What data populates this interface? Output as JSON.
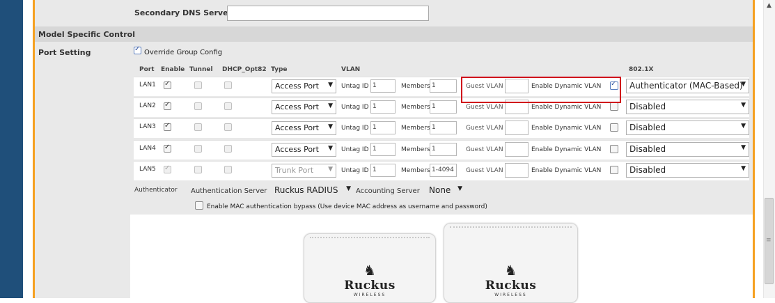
{
  "dns": {
    "secondary_label": "Secondary DNS Server",
    "secondary_value": ""
  },
  "section": {
    "title": "Model Specific Control"
  },
  "port_setting": {
    "label": "Port Setting",
    "override_label": "Override Group Config",
    "override_checked": true,
    "headers": {
      "port": "Port",
      "enable": "Enable",
      "tunnel": "Tunnel",
      "dhcp": "DHCP_Opt82",
      "type": "Type",
      "vlan": "VLAN",
      "dot1x": "802.1X"
    },
    "labels": {
      "untag": "Untag ID",
      "members": "Members",
      "guest": "Guest VLAN",
      "dynamic": "Enable Dynamic VLAN"
    },
    "rows": [
      {
        "port": "LAN1",
        "type": "Access Port",
        "untag": "1",
        "members": "1",
        "guest": "",
        "dynamic_checked": true,
        "auth": "Authenticator (MAC-Based)"
      },
      {
        "port": "LAN2",
        "type": "Access Port",
        "untag": "1",
        "members": "1",
        "guest": "",
        "dynamic_checked": false,
        "auth": "Disabled"
      },
      {
        "port": "LAN3",
        "type": "Access Port",
        "untag": "1",
        "members": "1",
        "guest": "",
        "dynamic_checked": false,
        "auth": "Disabled"
      },
      {
        "port": "LAN4",
        "type": "Access Port",
        "untag": "1",
        "members": "1",
        "guest": "",
        "dynamic_checked": false,
        "auth": "Disabled"
      },
      {
        "port": "LAN5",
        "type": "Trunk Port",
        "untag": "1",
        "members": "1-4094",
        "guest": "",
        "dynamic_checked": false,
        "auth": "Disabled"
      }
    ]
  },
  "authenticator": {
    "label": "Authenticator",
    "auth_server_label": "Authentication Server",
    "auth_server_value": "Ruckus RADIUS",
    "acct_server_label": "Accounting Server",
    "acct_server_value": "None",
    "bypass_label": "Enable MAC authentication bypass (Use device MAC address as username and password)",
    "bypass_checked": false
  },
  "devices": [
    {
      "brand": "Ruckus",
      "sub": "WIRELESS"
    },
    {
      "brand": "Ruckus",
      "sub": "WIRELESS"
    }
  ],
  "icons": {
    "scroll_up": "scroll-up-arrow-icon",
    "caret": "dropdown-caret-icon",
    "dog_logo": "ruckus-dog-logo-icon"
  },
  "colors": {
    "highlight": "#d0021b",
    "accent": "#f5a020",
    "sidebar": "#1f4f7a"
  }
}
